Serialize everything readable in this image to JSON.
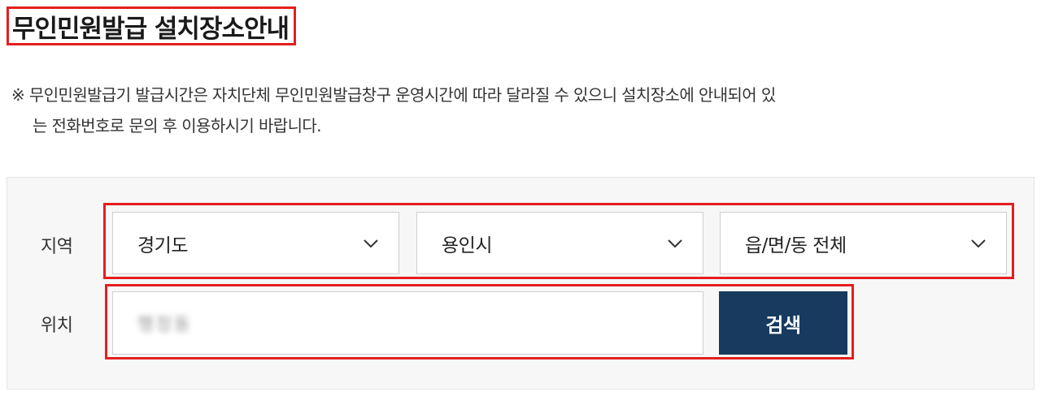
{
  "page": {
    "title": "무인민원발급 설치장소안내",
    "notice_line1": "※ 무인민원발급기 발급시간은 자치단체 무인민원발급창구 운영시간에 따라 달라질 수 있으니 설치장소에 안내되어 있",
    "notice_line2": "는 전화번호로 문의 후 이용하시기 바랍니다."
  },
  "search_form": {
    "region_label": "지역",
    "location_label": "위치",
    "province_select": {
      "value": "경기도",
      "icon": "chevron-down-icon"
    },
    "city_select": {
      "value": "용인시",
      "icon": "chevron-down-icon"
    },
    "town_select": {
      "value": "읍/면/동 전체",
      "icon": "chevron-down-icon"
    },
    "location_input": {
      "value": "행정동"
    },
    "search_button": {
      "label": "검색"
    }
  },
  "colors": {
    "highlight": "#e41e1e",
    "button_bg": "#173a5e",
    "panel_bg": "#f7f7f7"
  }
}
